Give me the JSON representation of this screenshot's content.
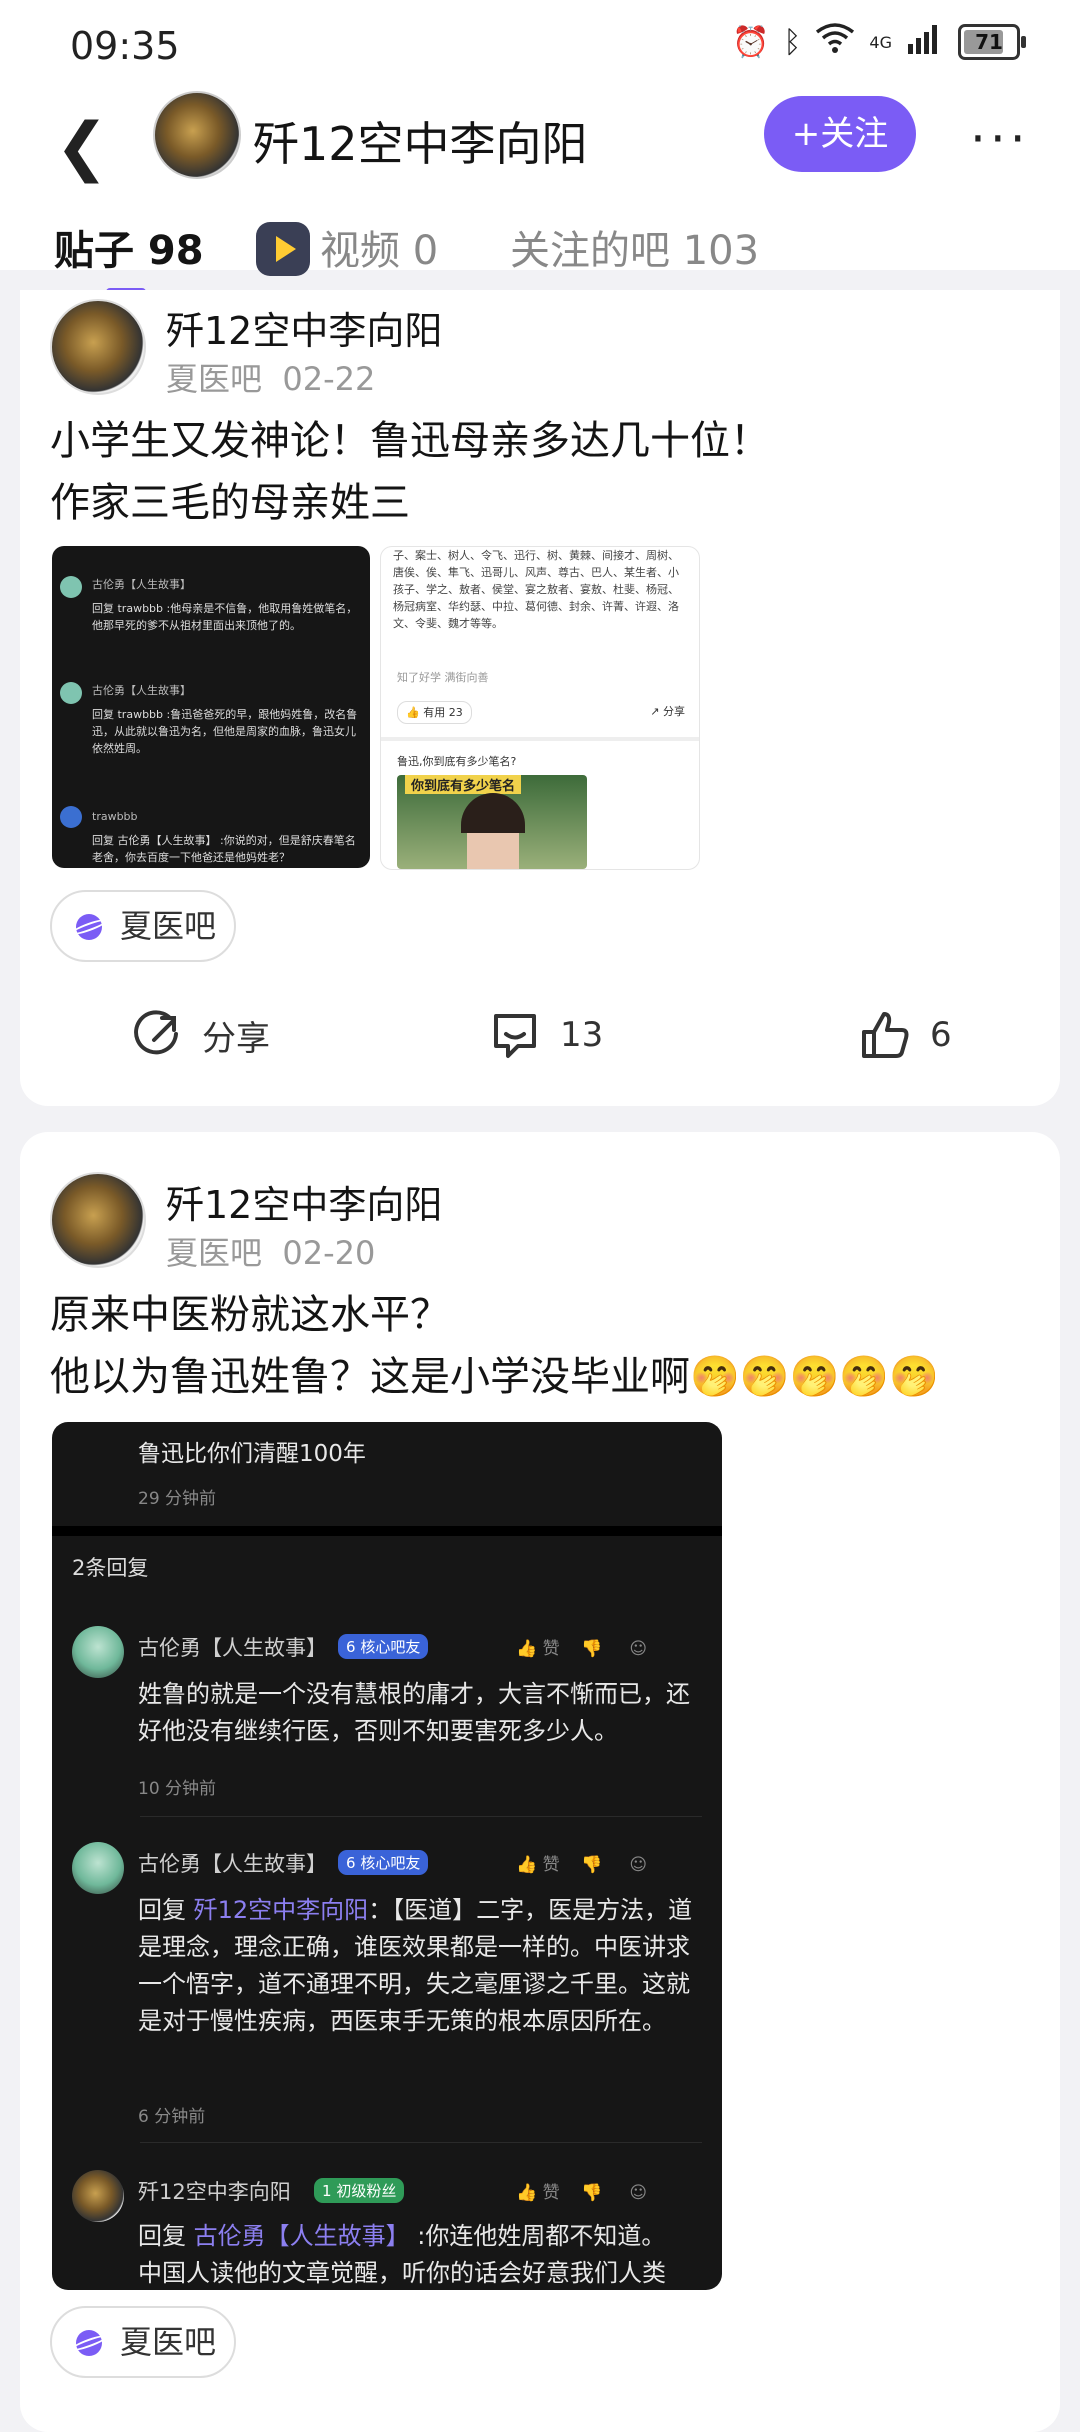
{
  "status": {
    "time": "09:35",
    "network": "4G",
    "battery": "71"
  },
  "header": {
    "username": "歼12空中李向阳",
    "follow_label": "+关注",
    "more_label": "···"
  },
  "tabs": [
    {
      "label": "贴子 98"
    },
    {
      "label": "视频 0"
    },
    {
      "label": "关注的吧 103"
    }
  ],
  "posts": [
    {
      "author": "歼12空中李向阳",
      "forum": "夏医吧",
      "date": "02-22",
      "title_line1": "小学生又发神论！鲁迅母亲多达几十位！",
      "title_line2": "作家三毛的母亲姓三",
      "forum_tag": "夏医吧",
      "share_label": "分享",
      "comments": "13",
      "likes": "6",
      "thumb_left": {
        "c1_name": "古伦勇【人生故事】",
        "c1_text": "回复 trawbbb :他母亲是不信鲁，他取用鲁姓做笔名，他那早死的爹不从祖材里面出来顶他了的。",
        "c2_name": "古伦勇【人生故事】",
        "c2_text": "回复 trawbbb :鲁迅爸爸死的早，跟他妈姓鲁，改名鲁迅，从此就以鲁迅为名，但他是周家的血脉，鲁迅女儿依然姓周。",
        "c3_name": "trawbbb",
        "c3_text": "回复 古伦勇【人生故事】 :你说的对，但是舒庆春笔名老舍，你去百度一下他爸还是他妈姓老？"
      },
      "thumb_right": {
        "text": "子、案士、树人、令飞、迅行、树、黄棘、间接才、周树、唐俟、俟、隼飞、迅哥儿、风声、尊古、巴人、某生者、小孩子、学之、敖者、侯堂、宴之敖者、宴敖、杜斐、杨冠、杨冠病室、华约瑟、中拉、葛何德、封余、许菁、许遐、洛文、令斐、魏才等等。",
        "source": "知了好学 满街向善",
        "useful": "有用 23",
        "share": "分享",
        "question": "鲁迅,你到底有多少笔名?",
        "banner": "你到底有多少笔名"
      }
    },
    {
      "author": "歼12空中李向阳",
      "forum": "夏医吧",
      "date": "02-20",
      "title_line1": "原来中医粉就这水平？",
      "title_line2": "他以为鲁迅姓鲁？这是小学没毕业啊🤭🤭🤭🤭🤭",
      "forum_tag": "夏医吧",
      "screenshot": {
        "top_comment": "鲁迅比你们清醒100年",
        "top_time": "29 分钟前",
        "reply_count": "2条回复",
        "r1_name": "古伦勇【人生故事】",
        "r1_badge": "核心吧友",
        "r1_text": "姓鲁的就是一个没有慧根的庸才，大言不惭而已，还好他没有继续行医，否则不知要害死多少人。",
        "r1_time": "10 分钟前",
        "r2_name": "古伦勇【人生故事】",
        "r2_badge": "核心吧友",
        "r2_prefix": "回复",
        "r2_link": "歼12空中李向阳",
        "r2_text": "：【医道】二字，医是方法，道是理念，理念正确，谁医效果都是一样的。中医讲求一个悟字，道不通理不明，失之毫厘谬之千里。这就是对于慢性疾病，西医束手无策的根本原因所在。",
        "r2_time": "6 分钟前",
        "r3_name": "歼12空中李向阳",
        "r3_badge": "初级粉丝",
        "r3_prefix": "回复",
        "r3_link": "古伦勇【人生故事】",
        "r3_text": " :你连他姓周都不知道。",
        "r3_text2": "中国人读他的文章觉醒，听你的话会好意我们人类",
        "act_like": "赞"
      }
    }
  ]
}
